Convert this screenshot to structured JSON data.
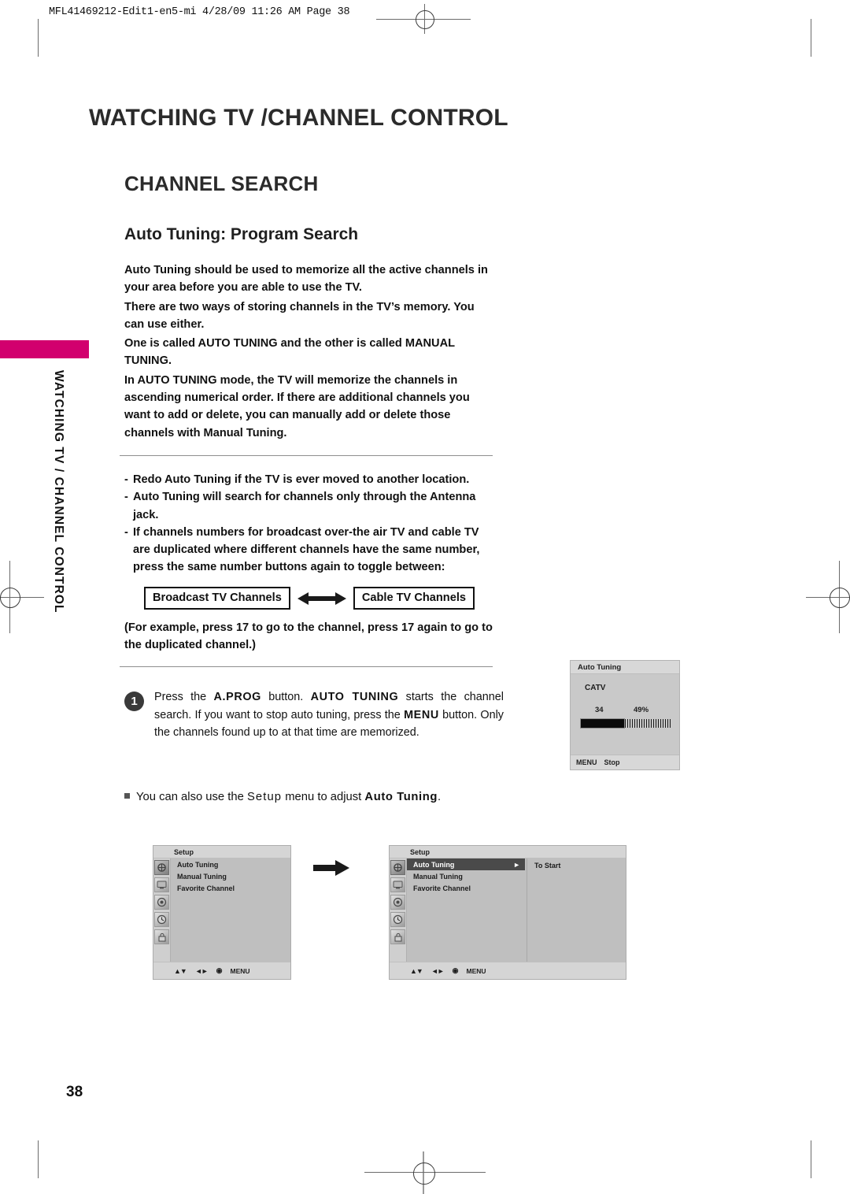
{
  "printer_slug": {
    "text": "MFL41469212-Edit1-en5-mi  4/28/09 11:26 AM  Page 38"
  },
  "side_tab": {
    "label": "WATCHING TV / CHANNEL CONTROL",
    "accent_color": "#d2006e"
  },
  "headings": {
    "section": "WATCHING TV /CHANNEL CONTROL",
    "title": "CHANNEL SEARCH",
    "subtitle": "Auto Tuning: Program Search"
  },
  "intro_paragraphs": [
    "Auto Tuning should be used to memorize all the active channels in your area before you are able to use the TV.",
    "There are two ways of storing channels in the TV’s memory. You can use either.",
    "One is called AUTO TUNING and the other is called MANUAL TUNING.",
    "In AUTO TUNING mode, the TV will memorize the channels in ascending numerical order. If there are additional channels you want to add or delete, you can manually add or delete those channels with Manual Tuning."
  ],
  "notes_list": [
    "Redo Auto Tuning if the TV is ever moved to another location.",
    "Auto Tuning will search for channels only through the Antenna jack.",
    "If channels numbers for broadcast over-the air TV and cable TV are duplicated where different channels have the same number, press the same number buttons again to toggle between:"
  ],
  "dash_marker": "-",
  "toggle": {
    "left_label": "Broadcast TV Channels",
    "right_label": "Cable TV Channels"
  },
  "example_text": "(For example, press 17 to go to the channel, press 17 again to go to the duplicated channel.)",
  "step": {
    "number": "1",
    "parts": [
      {
        "t": "Press the ",
        "b": false
      },
      {
        "t": "A.PROG",
        "b": true
      },
      {
        "t": " button. ",
        "b": false
      },
      {
        "t": "AUTO TUNING",
        "b": true
      },
      {
        "t": " starts the channel search. If you want to stop auto tuning, press the ",
        "b": false
      },
      {
        "t": "MENU",
        "b": true
      },
      {
        "t": " button. Only the channels found up to at that time are memorized.",
        "b": false
      }
    ]
  },
  "note_line": {
    "bullet_icon": "square-bullet-icon",
    "prefix": "You can also use the ",
    "emphasis1": "Setup",
    "middle": " menu to adjust ",
    "emphasis2": "Auto Tuning",
    "suffix": "."
  },
  "osd_auto_tuning": {
    "title": "Auto Tuning",
    "source": "CATV",
    "channel": "34",
    "percent_label": "49%",
    "percent_value": 49,
    "footer_key": "MENU",
    "footer_action": "Stop"
  },
  "osd_setup_left": {
    "title": "Setup",
    "items": [
      {
        "label": "Auto Tuning",
        "highlighted": false
      },
      {
        "label": "Manual Tuning",
        "highlighted": false
      },
      {
        "label": "Favorite Channel",
        "highlighted": false
      }
    ],
    "icons": [
      "setup-icon",
      "picture-icon",
      "audio-icon",
      "time-icon",
      "lock-icon"
    ],
    "footer": {
      "updown": "▲▼",
      "leftright": "◄►",
      "ok": "◉",
      "menu": "MENU"
    }
  },
  "osd_setup_right": {
    "title": "Setup",
    "items": [
      {
        "label": "Auto Tuning",
        "highlighted": true,
        "arrow": "►"
      },
      {
        "label": "Manual Tuning",
        "highlighted": false
      },
      {
        "label": "Favorite Channel",
        "highlighted": false
      }
    ],
    "icons": [
      "setup-icon",
      "picture-icon",
      "audio-icon",
      "time-icon",
      "lock-icon"
    ],
    "detail_label": "To Start",
    "footer": {
      "updown": "▲▼",
      "leftright": "◄►",
      "ok": "◉",
      "menu": "MENU"
    }
  },
  "page_number": "38"
}
